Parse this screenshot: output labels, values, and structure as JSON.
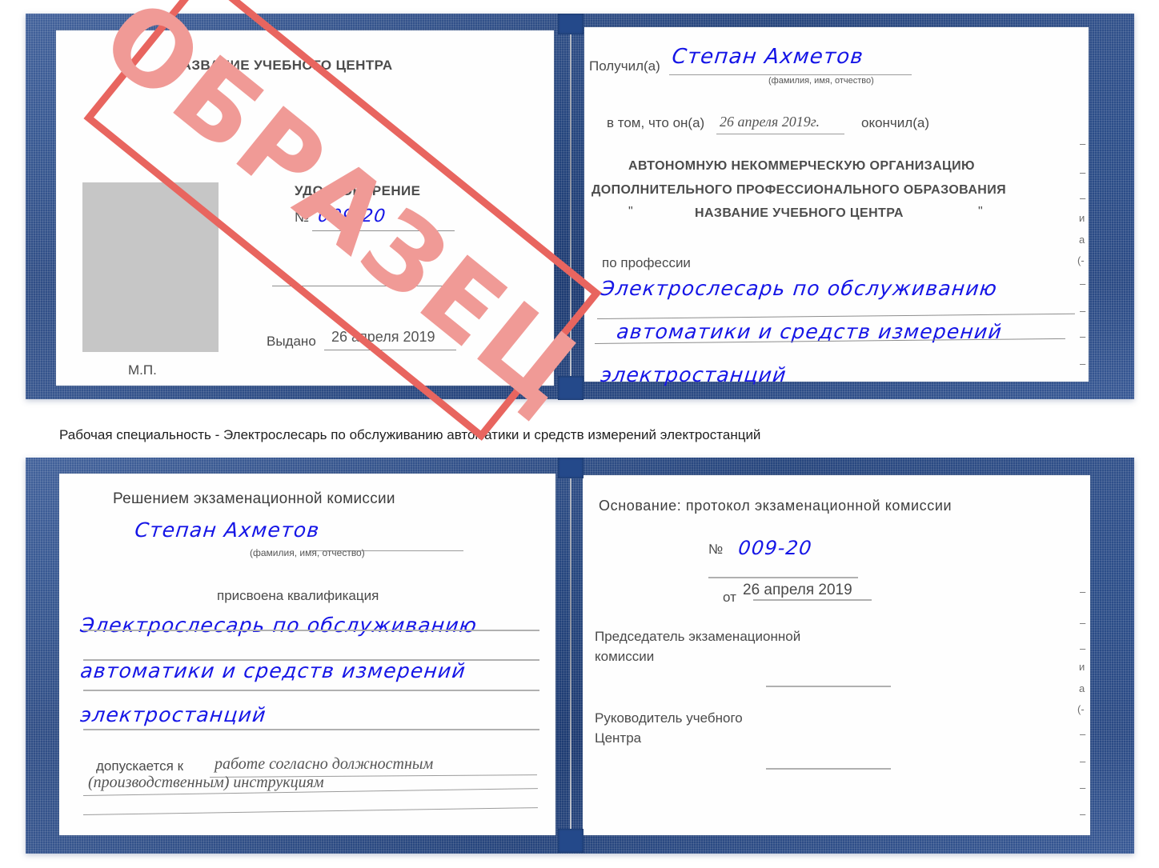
{
  "document": {
    "kind": "certificate-scan",
    "caption": "Рабочая специальность - Электрослесарь по обслуживанию автоматики и средств измерений электростанций",
    "stamp_text": "ОБРАЗЕЦ",
    "colors": {
      "cover_blue": "#24498a",
      "stamp_red": "#e8655f",
      "stamp_word": "#f09a96",
      "handwriting_blue": "#1515e6",
      "print_gray": "#4a4a4a",
      "photo_placeholder": "#c6c6c6",
      "rule_gray": "#8d8d8d"
    }
  },
  "certificate_top": {
    "left_page": {
      "heading": "НАЗВАНИЕ УЧЕБНОГО ЦЕНТРА",
      "title": "УДОСТОВЕРЕНИЕ",
      "number_label": "№",
      "number_value": "009-20",
      "issued_label": "Выдано",
      "issued_value": "26 апреля 2019",
      "seal_label": "М.П.",
      "photo_alt": "фото"
    },
    "right_page": {
      "received_label": "Получил(а)",
      "received_value": "Степан Ахметов",
      "fio_hint": "(фамилия, имя, отчество)",
      "that_label": "в том, что он(а)",
      "that_value": "26 апреля 2019г.",
      "finished_label": "окончил(а)",
      "org_line1": "АВТОНОМНУЮ НЕКОММЕРЧЕСКУЮ ОРГАНИЗАЦИЮ",
      "org_line2": "ДОПОЛНИТЕЛЬНОГО ПРОФЕССИОНАЛЬНОГО ОБРАЗОВАНИЯ",
      "org_quote_open": "\"",
      "org_line3": "НАЗВАНИЕ УЧЕБНОГО ЦЕНТРА",
      "org_quote_close": "\"",
      "profession_label": "по профессии",
      "profession_line1": "Электрослесарь по обслуживанию",
      "profession_line2": "автоматики и средств измерений",
      "profession_line3": "электростанций",
      "edge_marks": [
        "–",
        "–",
        "–",
        "и",
        "а",
        "(-",
        "–",
        "–",
        "–"
      ]
    }
  },
  "certificate_bottom": {
    "left_page": {
      "heading": "Решением экзаменационной комиссии",
      "name_value": "Степан Ахметов",
      "fio_hint": "(фамилия, имя, отчество)",
      "qualification_label": "присвоена квалификация",
      "qualification_line1": "Электрослесарь по обслуживанию",
      "qualification_line2": "автоматики и средств измерений",
      "qualification_line3": "электростанций",
      "admitted_label": "допускается к",
      "admitted_value1": "работе согласно должностным",
      "admitted_value2": "(производственным) инструкциям"
    },
    "right_page": {
      "basis_label": "Основание: протокол экзаменационной комиссии",
      "number_label": "№",
      "number_value": "009-20",
      "date_label": "от",
      "date_value": "26 апреля 2019",
      "chairman_line1": "Председатель экзаменационной",
      "chairman_line2": "комиссии",
      "head_line1": "Руководитель учебного",
      "head_line2": "Центра",
      "edge_marks": [
        "–",
        "–",
        "–",
        "и",
        "а",
        "(-",
        "–",
        "–",
        "–",
        "–"
      ]
    }
  }
}
